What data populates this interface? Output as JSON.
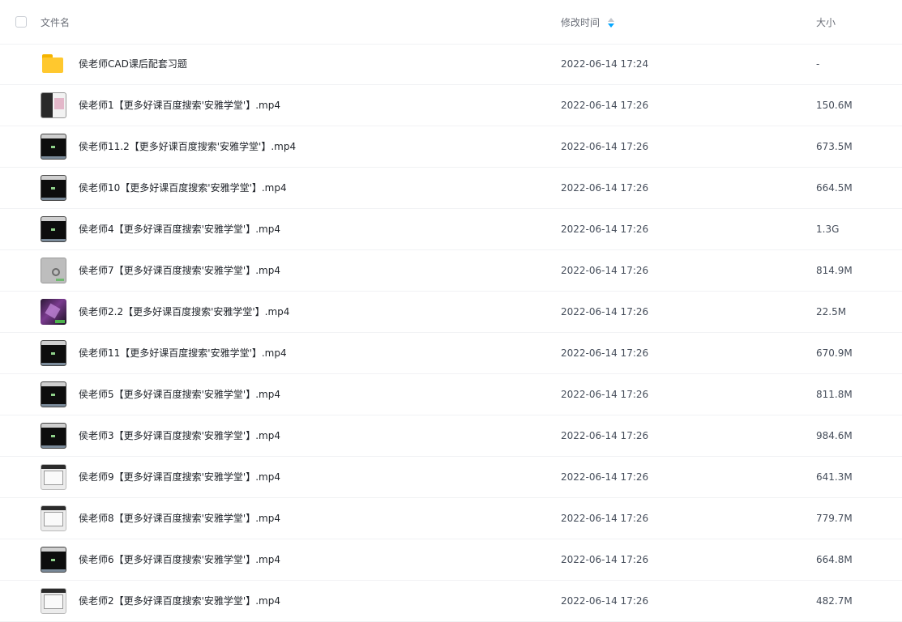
{
  "header": {
    "name_label": "文件名",
    "time_label": "修改时间",
    "size_label": "大小"
  },
  "files": [
    {
      "name": "侯老师CAD课后配套习题",
      "time": "2022-06-14 17:24",
      "size": "-",
      "thumb": "folder"
    },
    {
      "name": "侯老师1【更多好课百度搜索'安雅学堂'】.mp4",
      "time": "2022-06-14 17:26",
      "size": "150.6M",
      "thumb": "mixed"
    },
    {
      "name": "侯老师11.2【更多好课百度搜索'安雅学堂'】.mp4",
      "time": "2022-06-14 17:26",
      "size": "673.5M",
      "thumb": "dark"
    },
    {
      "name": "侯老师10【更多好课百度搜索'安雅学堂'】.mp4",
      "time": "2022-06-14 17:26",
      "size": "664.5M",
      "thumb": "dark"
    },
    {
      "name": "侯老师4【更多好课百度搜索'安雅学堂'】.mp4",
      "time": "2022-06-14 17:26",
      "size": "1.3G",
      "thumb": "dark"
    },
    {
      "name": "侯老师7【更多好课百度搜索'安雅学堂'】.mp4",
      "time": "2022-06-14 17:26",
      "size": "814.9M",
      "thumb": "grey"
    },
    {
      "name": "侯老师2.2【更多好课百度搜索'安雅学堂'】.mp4",
      "time": "2022-06-14 17:26",
      "size": "22.5M",
      "thumb": "purple"
    },
    {
      "name": "侯老师11【更多好课百度搜索'安雅学堂'】.mp4",
      "time": "2022-06-14 17:26",
      "size": "670.9M",
      "thumb": "dark"
    },
    {
      "name": "侯老师5【更多好课百度搜索'安雅学堂'】.mp4",
      "time": "2022-06-14 17:26",
      "size": "811.8M",
      "thumb": "dark"
    },
    {
      "name": "侯老师3【更多好课百度搜索'安雅学堂'】.mp4",
      "time": "2022-06-14 17:26",
      "size": "984.6M",
      "thumb": "dark"
    },
    {
      "name": "侯老师9【更多好课百度搜索'安雅学堂'】.mp4",
      "time": "2022-06-14 17:26",
      "size": "641.3M",
      "thumb": "light"
    },
    {
      "name": "侯老师8【更多好课百度搜索'安雅学堂'】.mp4",
      "time": "2022-06-14 17:26",
      "size": "779.7M",
      "thumb": "light"
    },
    {
      "name": "侯老师6【更多好课百度搜索'安雅学堂'】.mp4",
      "time": "2022-06-14 17:26",
      "size": "664.8M",
      "thumb": "dark"
    },
    {
      "name": "侯老师2【更多好课百度搜索'安雅学堂'】.mp4",
      "time": "2022-06-14 17:26",
      "size": "482.7M",
      "thumb": "light"
    }
  ],
  "colors": {
    "sort_active": "#06a7ff",
    "sort_inactive": "#c3c7ce",
    "folder": "#ffc82e"
  },
  "icons": {
    "sort": "sort-icon",
    "folder": "folder-icon",
    "video": "video-thumbnail-icon"
  }
}
